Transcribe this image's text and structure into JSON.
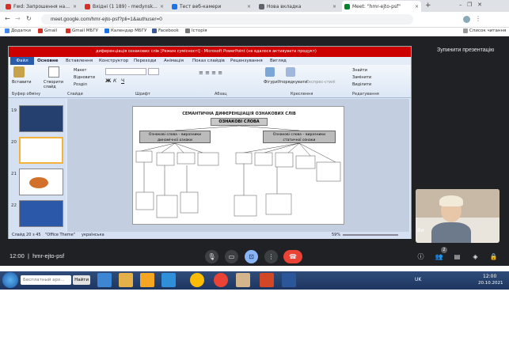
{
  "browser": {
    "tabs": [
      {
        "label": "Fwd: Запрошення на спільні...",
        "favicon_color": "#d93025"
      },
      {
        "label": "Вхідні (1 189) - medynsky.n...",
        "favicon_color": "#d93025"
      },
      {
        "label": "Тест веб-камери",
        "favicon_color": "#1a73e8"
      },
      {
        "label": "Нова вкладка",
        "favicon_color": "#5f6368"
      },
      {
        "label": "Meet: \"hmr-ejto-psf\"",
        "favicon_color": "#00832d"
      }
    ],
    "new_tab": "+",
    "url": "meet.google.com/hmr-ejto-psf?pli=1&authuser=0",
    "bookmarks": [
      "Додатки",
      "Gmail",
      "Gmail МБГУ",
      "Календар МБГУ",
      "Facebook",
      "Історія"
    ],
    "reading_list": "Список читання"
  },
  "meet": {
    "stop_presenting": "Зупинити презентацію",
    "time": "12:00",
    "meeting_code": "hmr-ejto-psf",
    "participant_name": "Ви",
    "participants_badge": "2"
  },
  "powerpoint": {
    "title": "диференціація ознакових слів [Режим сумісності] - Microsoft PowerPoint (не вдалося активувати продукт)",
    "file_tab": "Файл",
    "tabs": [
      "Основне",
      "Вставлення",
      "Конструктор",
      "Переходи",
      "Анімація",
      "Показ слайдів",
      "Рецензування",
      "Вигляд"
    ],
    "ribbon": {
      "paste": "Вставити",
      "new_slide": "Створити слайд",
      "layout": "Макет",
      "reset": "Відновити",
      "section": "Розділ",
      "shapes": "Фігури",
      "arrange": "Упорядкувати",
      "quick_styles": "Експрес-стилі",
      "find": "Знайти",
      "replace": "Замінити",
      "select": "Виділити",
      "groups": [
        "Буфер обміну",
        "Слайди",
        "Шрифт",
        "Абзац",
        "Креслення",
        "Редагування"
      ]
    },
    "slide_numbers": [
      "19",
      "20",
      "21",
      "22"
    ],
    "status": {
      "slide": "Слайд 20 з 45",
      "theme": "\"Office Theme\"",
      "language": "українська",
      "zoom": "59%"
    }
  },
  "slide": {
    "title": "СЕМАНТИЧНА ДИФЕРЕНЦІАЦІЯ ОЗНАКОВИХ СЛІВ",
    "root": "ОЗНАКОВІ СЛОВА",
    "left_branch": "Ознакові слова – виразники динамічної ознаки",
    "right_branch": "Ознакові слова – виразники статичної ознаки"
  },
  "taskbar": {
    "search_placeholder": "Бесплатный арх...",
    "search_button": "Найти",
    "lang": "UK",
    "time": "12:00",
    "date": "20.10.2021"
  }
}
